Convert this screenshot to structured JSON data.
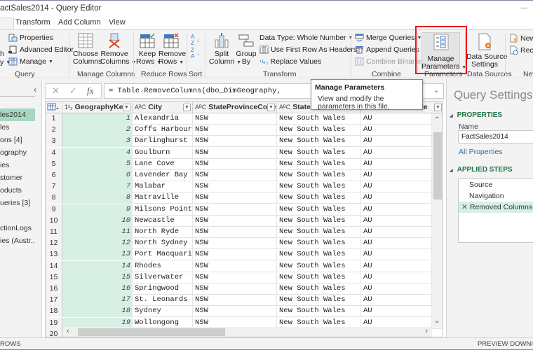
{
  "window": {
    "title": "actSales2014 - Query Editor"
  },
  "tabs": [
    {
      "label": ""
    },
    {
      "label": "Transform"
    },
    {
      "label": "Add Column"
    },
    {
      "label": "View"
    }
  ],
  "ribbon": {
    "query": {
      "partial_left_top": "h",
      "partial_left_bottom": "y",
      "properties": "Properties",
      "advanced_editor": "Advanced Editor",
      "manage": "Manage",
      "group_label": "Query"
    },
    "manage_columns": {
      "choose_line1": "Choose",
      "choose_line2": "Columns",
      "remove_line1": "Remove",
      "remove_line2": "Columns",
      "group_label": "Manage Columns"
    },
    "reduce_rows": {
      "keep_line1": "Keep",
      "keep_line2": "Rows",
      "remove_line1": "Remove",
      "remove_line2": "Rows",
      "group_label": "Reduce Rows"
    },
    "sort": {
      "asc": "A→Z",
      "desc": "Z→A",
      "group_label": "Sort"
    },
    "transform": {
      "split_line1": "Split",
      "split_line2": "Column",
      "group_line1": "Group",
      "group_line2": "By",
      "data_type": "Data Type: Whole Number",
      "first_row_headers": "Use First Row As Headers",
      "replace_values": "Replace Values",
      "group_label": "Transform"
    },
    "combine": {
      "merge": "Merge Queries",
      "append": "Append Queries",
      "combine_binaries": "Combine Binaries",
      "group_label": "Combine"
    },
    "parameters": {
      "manage_line1": "Manage",
      "manage_line2": "Parameters",
      "group_label": "Parameters"
    },
    "data_sources": {
      "line1": "Data Source",
      "line2": "Settings",
      "group_label": "Data Sources"
    },
    "new_query": {
      "new_source": "New",
      "recent_sources": "Rece",
      "group_label": "New"
    }
  },
  "left_pane": {
    "collapse_icon": "‹",
    "items": [
      {
        "label": "les2014",
        "selected": true
      },
      {
        "label": "les"
      },
      {
        "label": "ons [4]"
      },
      {
        "label": "ography"
      },
      {
        "label": "ies"
      },
      {
        "label": "stomer"
      },
      {
        "label": "oducts"
      },
      {
        "label": "ueries [3]"
      },
      {
        "label": ""
      },
      {
        "label": "ctionLogs"
      },
      {
        "label": "ies (Austr..."
      }
    ]
  },
  "formula_bar": {
    "cancel_icon": "✕",
    "commit_icon": "✓",
    "fx_icon": "fx",
    "formula": "= Table.RemoveColumns(dbo_DimGeography,",
    "expand_icon": "⌄"
  },
  "grid": {
    "columns": [
      {
        "type": "1²₃",
        "name": "GeographyKey"
      },
      {
        "type": "AᴮC",
        "name": "City"
      },
      {
        "type": "AᴮC",
        "name": "StateProvinceCode"
      },
      {
        "type": "AᴮC",
        "name": "StatePro"
      },
      {
        "type": "",
        "name": "le"
      }
    ],
    "rows": [
      {
        "n": "1",
        "key": "1",
        "city": "Alexandria",
        "code": "NSW",
        "state": "New South Wales",
        "country": "AU"
      },
      {
        "n": "2",
        "key": "2",
        "city": "Coffs Harbour",
        "code": "NSW",
        "state": "New South Wales",
        "country": "AU"
      },
      {
        "n": "3",
        "key": "3",
        "city": "Darlinghurst",
        "code": "NSW",
        "state": "New South Wales",
        "country": "AU"
      },
      {
        "n": "4",
        "key": "4",
        "city": "Goulburn",
        "code": "NSW",
        "state": "New South Wales",
        "country": "AU"
      },
      {
        "n": "5",
        "key": "5",
        "city": "Lane Cove",
        "code": "NSW",
        "state": "New South Wales",
        "country": "AU"
      },
      {
        "n": "6",
        "key": "6",
        "city": "Lavender Bay",
        "code": "NSW",
        "state": "New South Wales",
        "country": "AU"
      },
      {
        "n": "7",
        "key": "7",
        "city": "Malabar",
        "code": "NSW",
        "state": "New South Wales",
        "country": "AU"
      },
      {
        "n": "8",
        "key": "8",
        "city": "Matraville",
        "code": "NSW",
        "state": "New South Wales",
        "country": "AU"
      },
      {
        "n": "9",
        "key": "9",
        "city": "Milsons Point",
        "code": "NSW",
        "state": "New South Wales",
        "country": "AU"
      },
      {
        "n": "10",
        "key": "10",
        "city": "Newcastle",
        "code": "NSW",
        "state": "New South Wales",
        "country": "AU"
      },
      {
        "n": "11",
        "key": "11",
        "city": "North Ryde",
        "code": "NSW",
        "state": "New South Wales",
        "country": "AU"
      },
      {
        "n": "12",
        "key": "12",
        "city": "North Sydney",
        "code": "NSW",
        "state": "New South Wales",
        "country": "AU"
      },
      {
        "n": "13",
        "key": "13",
        "city": "Port Macquarie",
        "code": "NSW",
        "state": "New South Wales",
        "country": "AU"
      },
      {
        "n": "14",
        "key": "14",
        "city": "Rhodes",
        "code": "NSW",
        "state": "New South Wales",
        "country": "AU"
      },
      {
        "n": "15",
        "key": "15",
        "city": "Silverwater",
        "code": "NSW",
        "state": "New South Wales",
        "country": "AU"
      },
      {
        "n": "16",
        "key": "16",
        "city": "Springwood",
        "code": "NSW",
        "state": "New South Wales",
        "country": "AU"
      },
      {
        "n": "17",
        "key": "17",
        "city": "St. Leonards",
        "code": "NSW",
        "state": "New South Wales",
        "country": "AU"
      },
      {
        "n": "18",
        "key": "18",
        "city": "Sydney",
        "code": "NSW",
        "state": "New South Wales",
        "country": "AU"
      },
      {
        "n": "19",
        "key": "19",
        "city": "Wollongong",
        "code": "NSW",
        "state": "New South Wales",
        "country": "AU"
      },
      {
        "n": "20",
        "key": "",
        "city": "",
        "code": "",
        "state": "",
        "country": ""
      }
    ]
  },
  "tooltip": {
    "title": "Manage Parameters",
    "body": "View and modify the parameters in this file."
  },
  "query_settings": {
    "title": "Query Settings",
    "properties_header": "PROPERTIES",
    "name_label": "Name",
    "name_value": "FactSales2014",
    "all_properties": "All Properties",
    "applied_steps_header": "APPLIED STEPS",
    "steps": [
      {
        "label": "Source"
      },
      {
        "label": "Navigation"
      },
      {
        "label": "Removed Columns",
        "selected": true
      }
    ]
  },
  "status_bar": {
    "left": "ROWS",
    "right": "PREVIEW DOWNI"
  },
  "colors": {
    "accent_green": "#217346",
    "selected_green": "#a7d8bf",
    "key_column_bg": "#d8f0e3",
    "highlight_red": "#e8141b",
    "link_blue": "#2d6da3"
  }
}
